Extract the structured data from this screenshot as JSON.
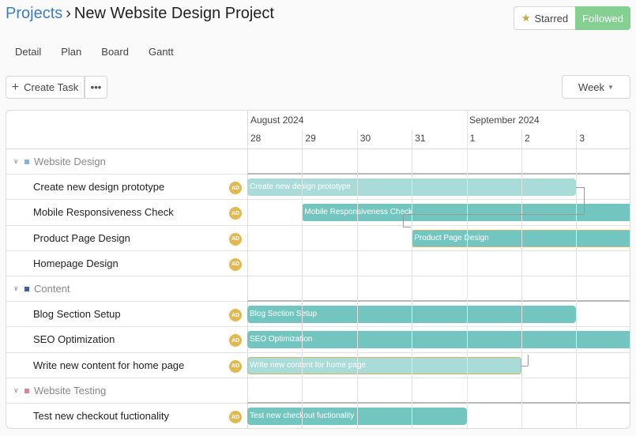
{
  "header": {
    "breadcrumb_root": "Projects",
    "separator": "›",
    "project_name": "New Website Design Project",
    "starred_label": "Starred",
    "followed_label": "Followed"
  },
  "tabs": [
    "Detail",
    "Plan",
    "Board",
    "Gantt"
  ],
  "toolbar": {
    "create_label": "Create Task",
    "more_label": "•••",
    "scale_label": "Week"
  },
  "timeline": {
    "months": [
      {
        "label": "August 2024"
      },
      {
        "label": "September 2024"
      }
    ],
    "days": [
      "28",
      "29",
      "30",
      "31",
      "1",
      "2",
      "3"
    ]
  },
  "rows": [
    {
      "type": "group",
      "label": "Website Design",
      "color": "#7fb6dd"
    },
    {
      "type": "task",
      "label": "Create new design prototype",
      "assignee": "AD",
      "bar": {
        "label": "Create new design prototype",
        "start": "2024-08-28",
        "end": "2024-09-03",
        "style": "light"
      }
    },
    {
      "type": "task",
      "label": "Mobile Responsiveness Check",
      "assignee": "AD",
      "bar": {
        "label": "Mobile Responsiveness Check",
        "start": "2024-08-29",
        "end": "",
        "style": "dark"
      }
    },
    {
      "type": "task",
      "label": "Product Page Design",
      "assignee": "AD",
      "bar": {
        "label": "Product Page Design",
        "start": "2024-08-31",
        "end": "",
        "style": "dark-outlined"
      }
    },
    {
      "type": "task",
      "label": "Homepage Design",
      "assignee": "AD"
    },
    {
      "type": "group",
      "label": "Content",
      "color": "#3d5fa8"
    },
    {
      "type": "task",
      "label": "Blog Section Setup",
      "assignee": "AD",
      "bar": {
        "label": "Blog Section Setup",
        "start": "2024-08-28",
        "end": "2024-09-03",
        "style": "dark"
      }
    },
    {
      "type": "task",
      "label": "SEO Optimization",
      "assignee": "AD",
      "bar": {
        "label": "SEO Optimization",
        "start": "2024-08-28",
        "end": "",
        "style": "dark"
      }
    },
    {
      "type": "task",
      "label": "Write new content for home page",
      "assignee": "AD",
      "bar": {
        "label": "Write new content for home page",
        "start": "2024-08-28",
        "end": "2024-09-02",
        "style": "light-outlined"
      }
    },
    {
      "type": "group",
      "label": "Website Testing",
      "color": "#d9869c"
    },
    {
      "type": "task",
      "label": "Test new checkout fuctionality",
      "assignee": "AD",
      "bar": {
        "label": "Test new checkout fuctionality",
        "start": "2024-08-28",
        "end": "2024-09-01",
        "style": "dark"
      }
    }
  ],
  "colors": {
    "accent": "#3f7cc4",
    "followed": "#84d091",
    "bar_dark": "#73c6bf",
    "bar_light": "#a9dcd8",
    "avatar": "#e2b851"
  }
}
